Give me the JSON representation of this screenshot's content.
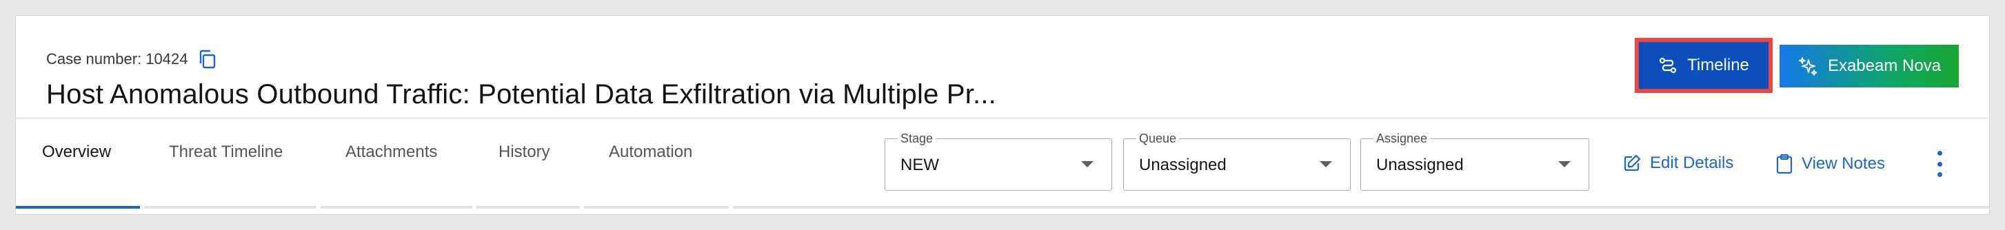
{
  "case": {
    "number_label": "Case number: 10424",
    "title": "Host Anomalous Outbound Traffic: Potential Data Exfiltration via Multiple Pr..."
  },
  "header_actions": {
    "timeline_label": "Timeline",
    "nova_label": "Exabeam Nova"
  },
  "tabs": [
    {
      "label": "Overview",
      "active": true
    },
    {
      "label": "Threat Timeline",
      "active": false
    },
    {
      "label": "Attachments",
      "active": false
    },
    {
      "label": "History",
      "active": false
    },
    {
      "label": "Automation",
      "active": false
    }
  ],
  "fields": {
    "stage": {
      "label": "Stage",
      "value": "NEW"
    },
    "queue": {
      "label": "Queue",
      "value": "Unassigned"
    },
    "assignee": {
      "label": "Assignee",
      "value": "Unassigned"
    }
  },
  "actions": {
    "edit_details": "Edit Details",
    "view_notes": "View Notes"
  },
  "colors": {
    "primary_button": "#0b4fbd",
    "highlight_border": "#ea4548",
    "link": "#1f64cc",
    "active_tab_underline": "#1b63c9"
  },
  "icons": {
    "copy": "copy-icon",
    "timeline": "timeline-icon",
    "nova": "sparkles-icon",
    "edit": "edit-icon",
    "notes": "clipboard-icon",
    "more": "more-vertical-icon"
  }
}
